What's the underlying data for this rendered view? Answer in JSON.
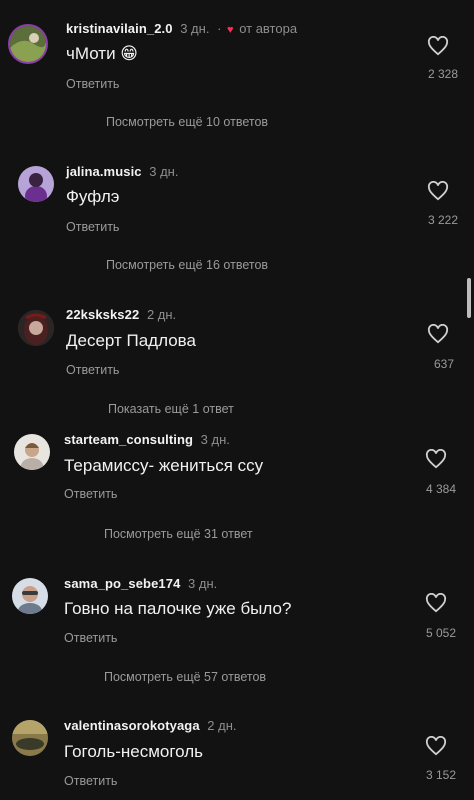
{
  "comments": [
    {
      "username": "kristinavilain_2.0",
      "time": "3 дн.",
      "separator": "·",
      "author_heart": "♥",
      "author_label": "от автора",
      "text": "чМоти 😁",
      "reply": "Ответить",
      "likes": "2 328",
      "more": "Посмотреть ещё 10 ответов"
    },
    {
      "username": "jalina.music",
      "time": "3 дн.",
      "text": "Фуфлэ",
      "reply": "Ответить",
      "likes": "3 222",
      "more": "Посмотреть ещё 16 ответов"
    },
    {
      "username": "22ksksks22",
      "time": "2 дн.",
      "text": "Десерт Падлова",
      "reply": "Ответить",
      "likes": "637",
      "more": "Показать ещё 1 ответ"
    },
    {
      "username": "starteam_consulting",
      "time": "3 дн.",
      "text": "Терамиссу- жениться ссу",
      "reply": "Ответить",
      "likes": "4 384",
      "more": "Посмотреть ещё 31 ответ"
    },
    {
      "username": "sama_po_sebe174",
      "time": "3 дн.",
      "text": "Говно на палочке уже было?",
      "reply": "Ответить",
      "likes": "5 052",
      "more": "Посмотреть ещё 57 ответов"
    },
    {
      "username": "valentinasorokotyaga",
      "time": "2 дн.",
      "text": "Гоголь-несмоголь",
      "reply": "Ответить",
      "likes": "3 152"
    }
  ]
}
